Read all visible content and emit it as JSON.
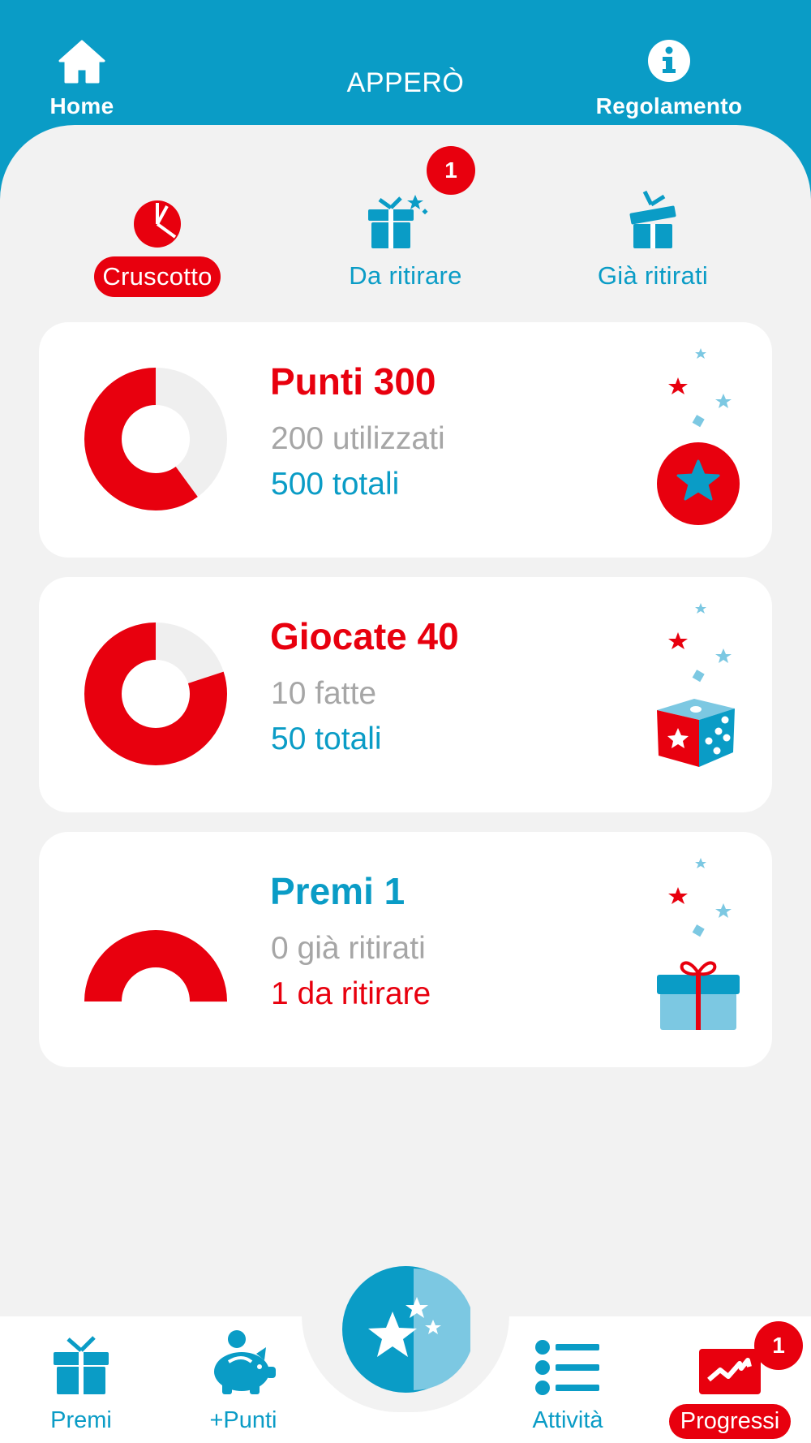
{
  "header": {
    "home_label": "Home",
    "title": "APPERÒ",
    "rules_label": "Regolamento"
  },
  "tabs": [
    {
      "label": "Cruscotto",
      "icon": "pie-chart-icon",
      "active": true
    },
    {
      "label": "Da ritirare",
      "icon": "gift-icon",
      "badge": "1"
    },
    {
      "label": "Già ritirati",
      "icon": "open-gift-icon"
    }
  ],
  "cards": [
    {
      "title": "Punti 300",
      "line1": "200 utilizzati",
      "line2": "500 totali",
      "progress": 0.6,
      "icon": "star-coin-icon"
    },
    {
      "title": "Giocate 40",
      "line1": "10 fatte",
      "line2": "50 totali",
      "progress": 0.8,
      "icon": "dice-icon"
    },
    {
      "title": "Premi 1",
      "line1": "0 già ritirati",
      "line2": "1 da ritirare",
      "progress": 0.5,
      "icon": "gift-box-icon"
    }
  ],
  "bottom_nav": [
    {
      "label": "Premi",
      "icon": "gift-icon"
    },
    {
      "label": "+Punti",
      "icon": "piggy-bank-icon"
    },
    {
      "label": "Attività",
      "icon": "list-icon"
    },
    {
      "label": "Progressi",
      "icon": "progress-icon",
      "active": true,
      "badge": "1"
    }
  ],
  "colors": {
    "primary_blue": "#0a9cc6",
    "accent_red": "#e8000e",
    "background": "#f2f2f2"
  }
}
